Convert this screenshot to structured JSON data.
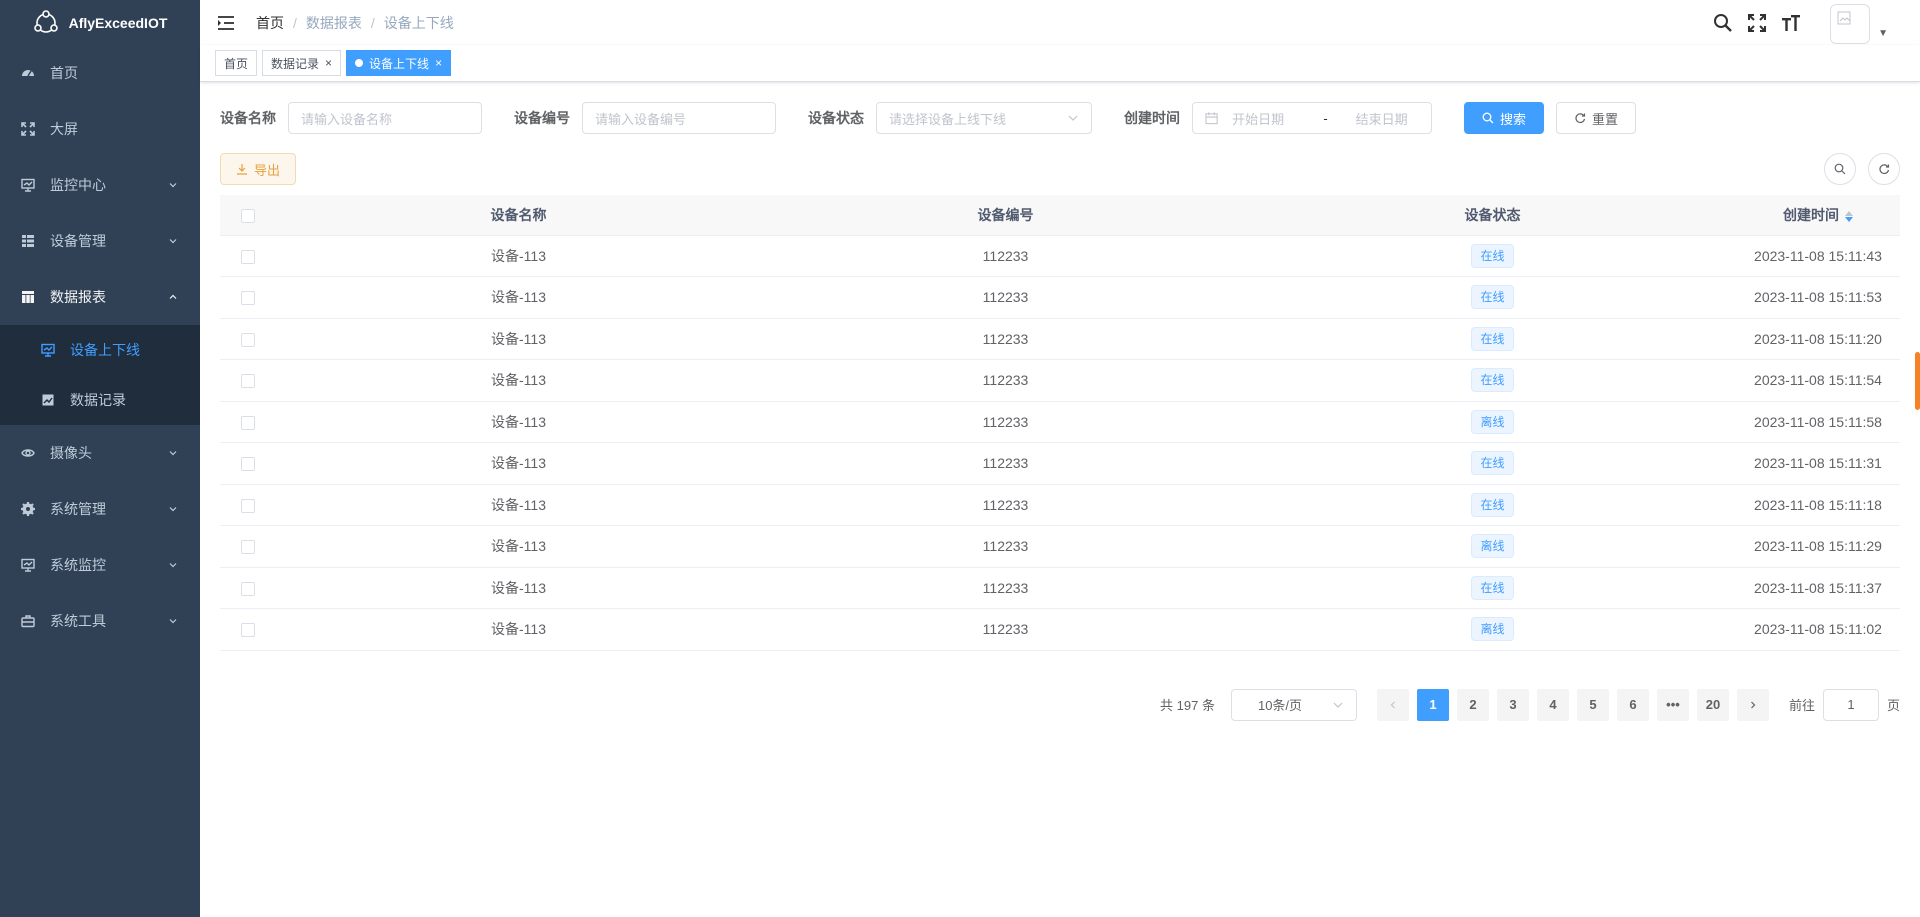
{
  "sidebar": {
    "logo_text": "AflyExceedIOT",
    "items": [
      {
        "label": "首页",
        "icon": "dashboard-icon"
      },
      {
        "label": "大屏",
        "icon": "fullscreen-icon"
      },
      {
        "label": "监控中心",
        "icon": "monitor-icon"
      },
      {
        "label": "设备管理",
        "icon": "tree-table-icon"
      },
      {
        "label": "数据报表",
        "icon": "table-icon"
      },
      {
        "label": "摄像头",
        "icon": "eye-icon"
      },
      {
        "label": "系统管理",
        "icon": "system-icon"
      },
      {
        "label": "系统监控",
        "icon": "monitor-icon"
      },
      {
        "label": "系统工具",
        "icon": "tool-icon"
      }
    ],
    "submenu": [
      {
        "label": "设备上下线",
        "icon": "monitor-icon"
      },
      {
        "label": "数据记录",
        "icon": "chart-icon"
      }
    ]
  },
  "navbar": {
    "breadcrumb": [
      "首页",
      "数据报表",
      "设备上下线"
    ]
  },
  "tags": [
    {
      "label": "首页"
    },
    {
      "label": "数据记录"
    },
    {
      "label": "设备上下线"
    }
  ],
  "search": {
    "name_label": "设备名称",
    "name_placeholder": "请输入设备名称",
    "code_label": "设备编号",
    "code_placeholder": "请输入设备编号",
    "status_label": "设备状态",
    "status_placeholder": "请选择设备上线下线",
    "time_label": "创建时间",
    "start_placeholder": "开始日期",
    "range_sep": "-",
    "end_placeholder": "结束日期",
    "search_btn": "搜索",
    "reset_btn": "重置"
  },
  "toolbar": {
    "export_btn": "导出"
  },
  "table": {
    "columns": [
      "设备名称",
      "设备编号",
      "设备状态",
      "创建时间"
    ],
    "rows": [
      {
        "name": "设备-113",
        "code": "112233",
        "status": "在线",
        "time": "2023-11-08 15:11:43"
      },
      {
        "name": "设备-113",
        "code": "112233",
        "status": "在线",
        "time": "2023-11-08 15:11:53"
      },
      {
        "name": "设备-113",
        "code": "112233",
        "status": "在线",
        "time": "2023-11-08 15:11:20"
      },
      {
        "name": "设备-113",
        "code": "112233",
        "status": "在线",
        "time": "2023-11-08 15:11:54"
      },
      {
        "name": "设备-113",
        "code": "112233",
        "status": "离线",
        "time": "2023-11-08 15:11:58"
      },
      {
        "name": "设备-113",
        "code": "112233",
        "status": "在线",
        "time": "2023-11-08 15:11:31"
      },
      {
        "name": "设备-113",
        "code": "112233",
        "status": "在线",
        "time": "2023-11-08 15:11:18"
      },
      {
        "name": "设备-113",
        "code": "112233",
        "status": "离线",
        "time": "2023-11-08 15:11:29"
      },
      {
        "name": "设备-113",
        "code": "112233",
        "status": "在线",
        "time": "2023-11-08 15:11:37"
      },
      {
        "name": "设备-113",
        "code": "112233",
        "status": "离线",
        "time": "2023-11-08 15:11:02"
      }
    ]
  },
  "pagination": {
    "total": "共 197 条",
    "page_size": "10条/页",
    "pages": [
      "1",
      "2",
      "3",
      "4",
      "5",
      "6",
      "•••",
      "20"
    ],
    "current": "1",
    "jump_label": "前往",
    "jump_value": "1",
    "page_suffix": "页"
  },
  "colors": {
    "sidebar_bg": "#304156",
    "submenu_bg": "#1f2d3d",
    "primary": "#409eff",
    "warning": "#e6a23c"
  }
}
